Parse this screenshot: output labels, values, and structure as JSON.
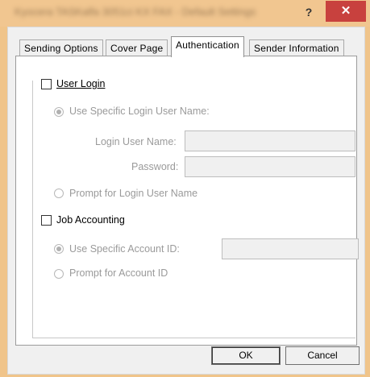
{
  "titlebar": {
    "title": "Kyocera TASKalfa 3051ci KX FAX - Default Settings",
    "help": "?",
    "close": "✕"
  },
  "tabs": [
    {
      "label": "Sending Options"
    },
    {
      "label": "Cover Page"
    },
    {
      "label": "Authentication",
      "active": true
    },
    {
      "label": "Sender Information"
    }
  ],
  "auth": {
    "user_login": {
      "label": "User Login",
      "checked": false
    },
    "use_specific_login": {
      "label": "Use Specific Login User Name:",
      "selected": true
    },
    "login_user_name_label": "Login User Name:",
    "login_user_name_value": "",
    "password_label": "Password:",
    "password_value": "",
    "prompt_login": {
      "label": "Prompt for Login User Name",
      "selected": false
    },
    "job_accounting": {
      "label": "Job Accounting",
      "checked": false
    },
    "use_specific_account": {
      "label": "Use Specific Account ID:",
      "selected": true
    },
    "account_id_value": "",
    "prompt_account": {
      "label": "Prompt for Account ID",
      "selected": false
    }
  },
  "buttons": {
    "ok": "OK",
    "cancel": "Cancel"
  }
}
